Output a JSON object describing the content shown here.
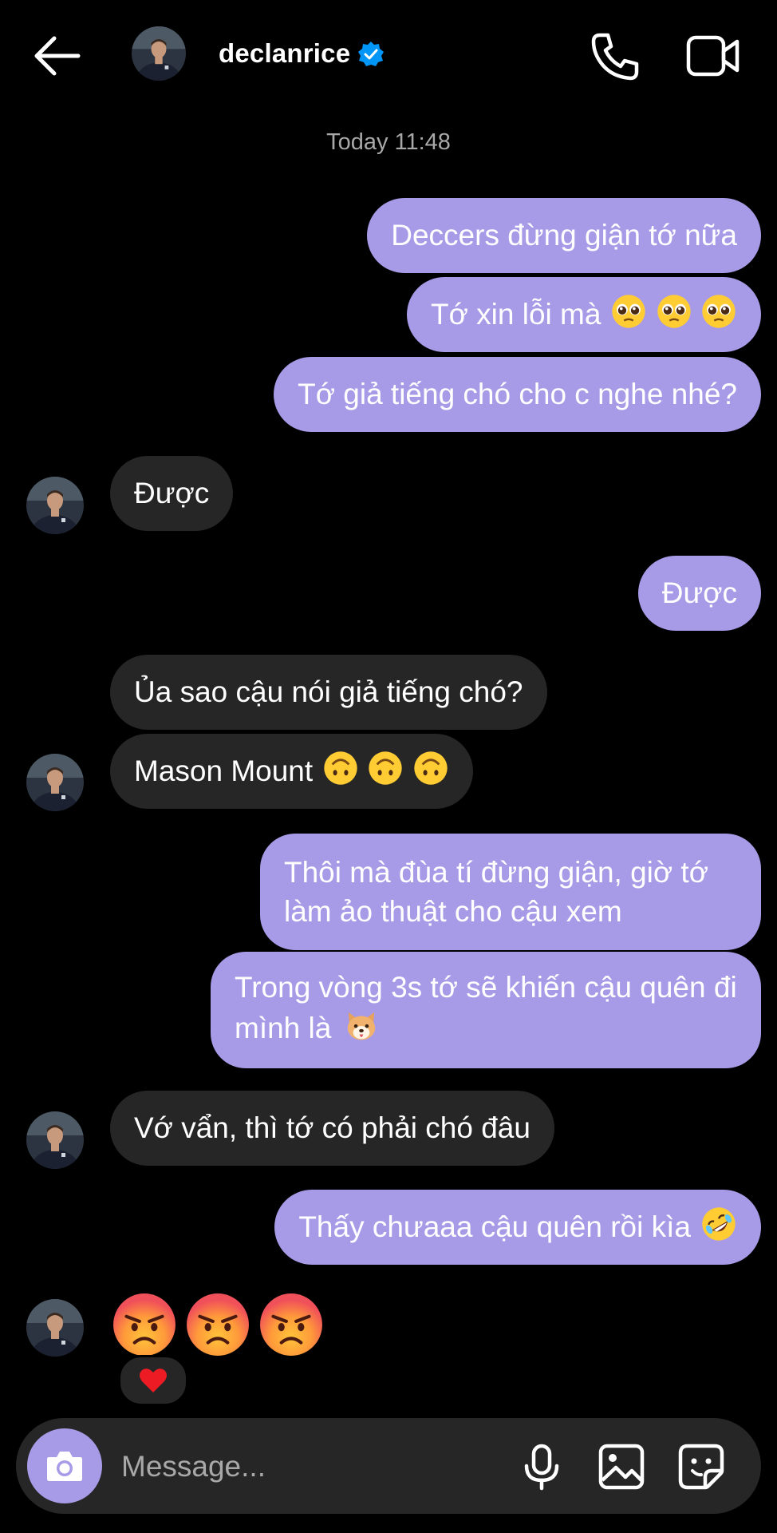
{
  "header": {
    "username": "declanrice",
    "verified": true,
    "icons": [
      "back-arrow-icon",
      "phone-icon",
      "video-camera-icon"
    ]
  },
  "timestamp": "Today 11:48",
  "messages": [
    {
      "dir": "out",
      "text": "Deccers đừng giận tớ nữa"
    },
    {
      "dir": "out",
      "text": "Tớ xin lỗi mà",
      "emoji": "pleading-face-x3"
    },
    {
      "dir": "out",
      "text": "Tớ giả tiếng chó cho c nghe nhé?"
    },
    {
      "dir": "in",
      "text": "Được"
    },
    {
      "dir": "out",
      "text": "Được"
    },
    {
      "dir": "in",
      "text": "Ủa sao cậu nói giả tiếng chó?"
    },
    {
      "dir": "in",
      "text": "Mason Mount",
      "emoji": "upside-down-face-x3"
    },
    {
      "dir": "out",
      "text": "Thôi mà đùa tí đừng giận, giờ tớ làm ảo thuật cho cậu xem"
    },
    {
      "dir": "out",
      "text": "Trong vòng 3s tớ sẽ khiến cậu quên đi mình là",
      "emoji": "dog-face"
    },
    {
      "dir": "in",
      "text": "Vớ vẩn, thì tớ có phải chó đâu"
    },
    {
      "dir": "out",
      "text": "Thấy chưaaa cậu quên rồi kìa",
      "emoji": "rolling-on-floor-laughing"
    },
    {
      "dir": "in",
      "emoji": "angry-face-x3",
      "reaction": "heart"
    }
  ],
  "composer": {
    "placeholder": "Message...",
    "icons": [
      "camera-icon",
      "microphone-icon",
      "gallery-icon",
      "sticker-icon"
    ]
  },
  "colors": {
    "background": "#000000",
    "outgoing_bubble": "#a79be8",
    "incoming_bubble": "#262626",
    "verified_badge": "#0095f6"
  }
}
